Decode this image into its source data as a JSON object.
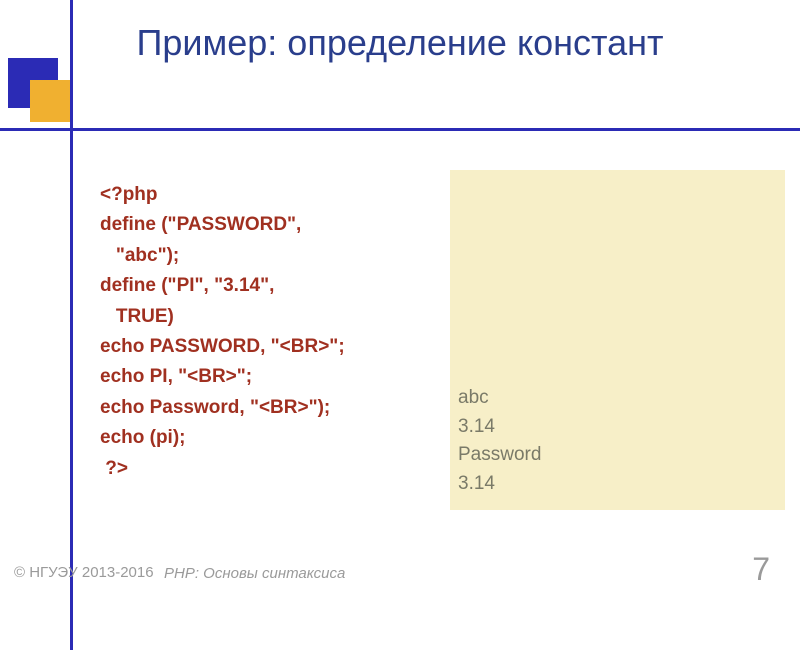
{
  "title": "Пример: определение констант",
  "code": {
    "l1": "<?php",
    "l2": "define (\"PASSWORD\",",
    "l2b": "   \"abc\");",
    "l3": "define (\"PI\", \"3.14\",",
    "l3b": "   TRUE)",
    "l4": "echo PASSWORD, \"<BR>\";",
    "l5": "echo PI, \"<BR>\";",
    "l6": "echo Password, \"<BR>\");",
    "l7": "echo (pi);",
    "l8": " ?>"
  },
  "output": {
    "l1": "abc",
    "l2": "3.14",
    "l3": "Password",
    "l4": "3.14"
  },
  "footer": {
    "copyright": "© НГУЭУ 2013-2016",
    "subtitle": "PHP: Основы синтаксиса",
    "page": "7"
  }
}
